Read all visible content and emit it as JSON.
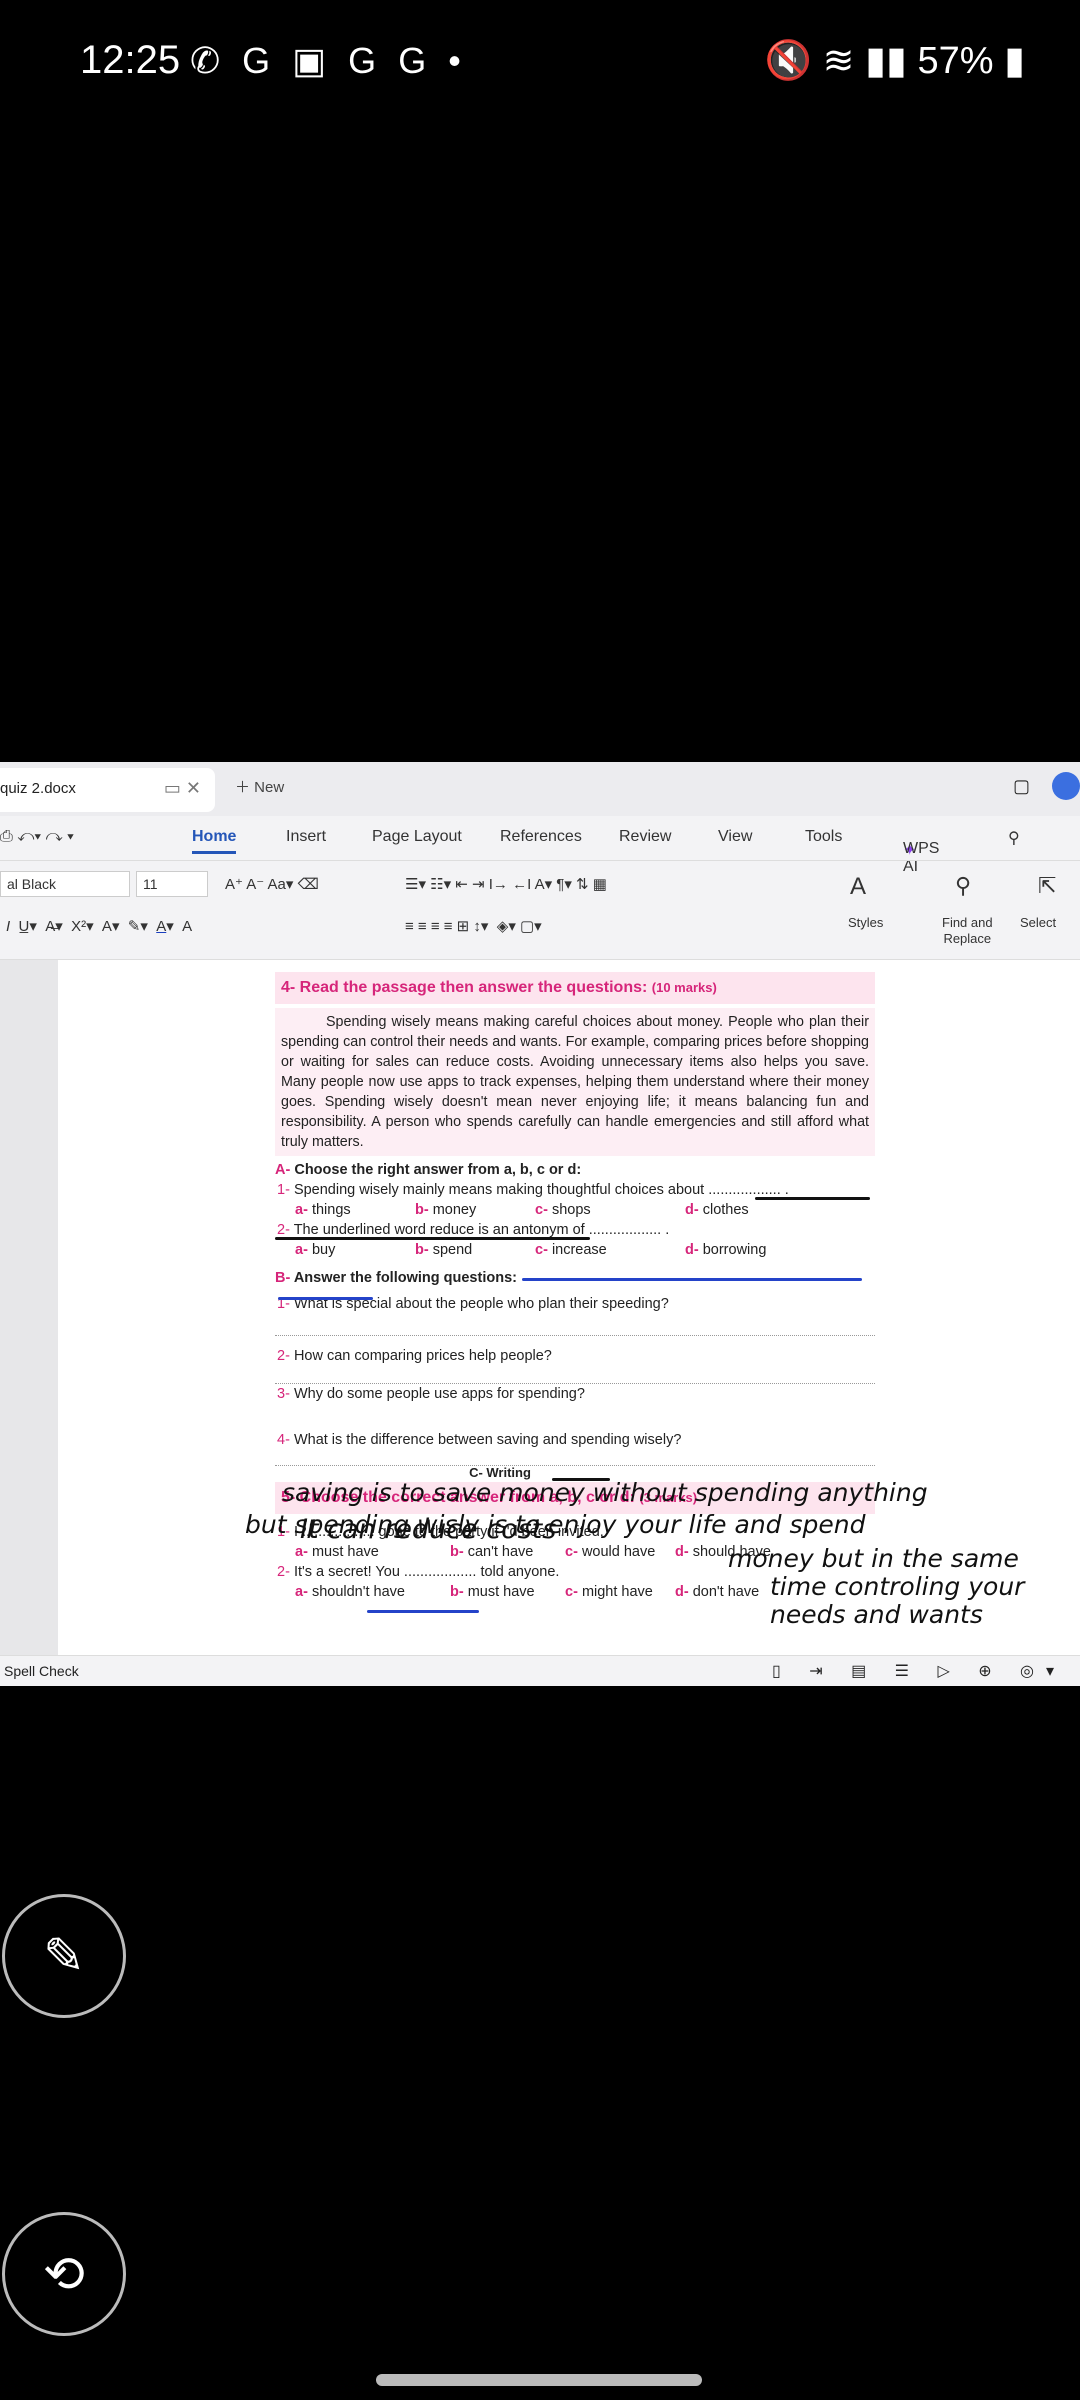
{
  "status": {
    "time": "12:25",
    "notif_icons": "whatsapp-icon google-icon gallery-icon google-icon google-icon",
    "battery": "57%"
  },
  "wps": {
    "doc_tab": "quiz 2.docx",
    "new_tab": "New",
    "menu": [
      "Home",
      "Insert",
      "Page Layout",
      "References",
      "Review",
      "View",
      "Tools"
    ],
    "wps_ai": "WPS AI",
    "font": "al Black",
    "size": "11",
    "styles": "Styles",
    "find": "Find and",
    "replace": "Replace",
    "select": "Select",
    "spell": "Spell Check"
  },
  "doc": {
    "heading": "4- Read the passage then answer the questions:",
    "heading_marks": "(10 marks)",
    "passage": "Spending wisely means making careful choices about money. People who plan their spending can control their needs and wants. For example, comparing prices before shopping or waiting for sales can reduce costs. Avoiding unnecessary items also helps you save. Many people now use apps to track expenses, helping them understand where their money goes. Spending wisely doesn't mean never enjoying life; it means balancing fun and responsibility. A person who spends carefully can handle emergencies and still afford what truly matters.",
    "secA_letter": "A-",
    "secA": "Choose the right answer from a, b, c or d:",
    "qa1": "Spending wisely mainly means making thoughtful choices about .................. .",
    "qa1_opts": [
      "things",
      "money",
      "shops",
      "clothes"
    ],
    "qa2": "The underlined word reduce is an antonym of .................. .",
    "qa2_opts": [
      "buy",
      "spend",
      "increase",
      "borrowing"
    ],
    "secB_letter": "B-",
    "secB": "Answer the following questions:",
    "qb1": "What is special about the people who plan their speeding?",
    "qb2": "How can comparing prices help people?",
    "qb3": "Why do some people use apps for spending?",
    "qb4": "What is the difference between saving and spending wisely?",
    "secC": "C- Writing",
    "heading5": "5- Choose the correct answer from a, b, c or d:",
    "heading5_marks": "(3 marks)",
    "q51": "I .................. gone to the party if I'd been invited.",
    "q51_opts": [
      "must have",
      "can't have",
      "would have",
      "should have"
    ],
    "q52": "It's a secret! You .................. told anyone.",
    "q52_opts": [
      "shouldn't have",
      "must have",
      "might have",
      "don't have"
    ]
  },
  "handwriting": {
    "a2": "It can reduce costs",
    "a4_l1": "saving is to save money without spending anything",
    "a4_l2": "but spending wisly is to enjoy your life and spend",
    "a4_l3": "money but in the same",
    "a4_l4": "time controling your",
    "a4_l5": "needs and wants"
  }
}
